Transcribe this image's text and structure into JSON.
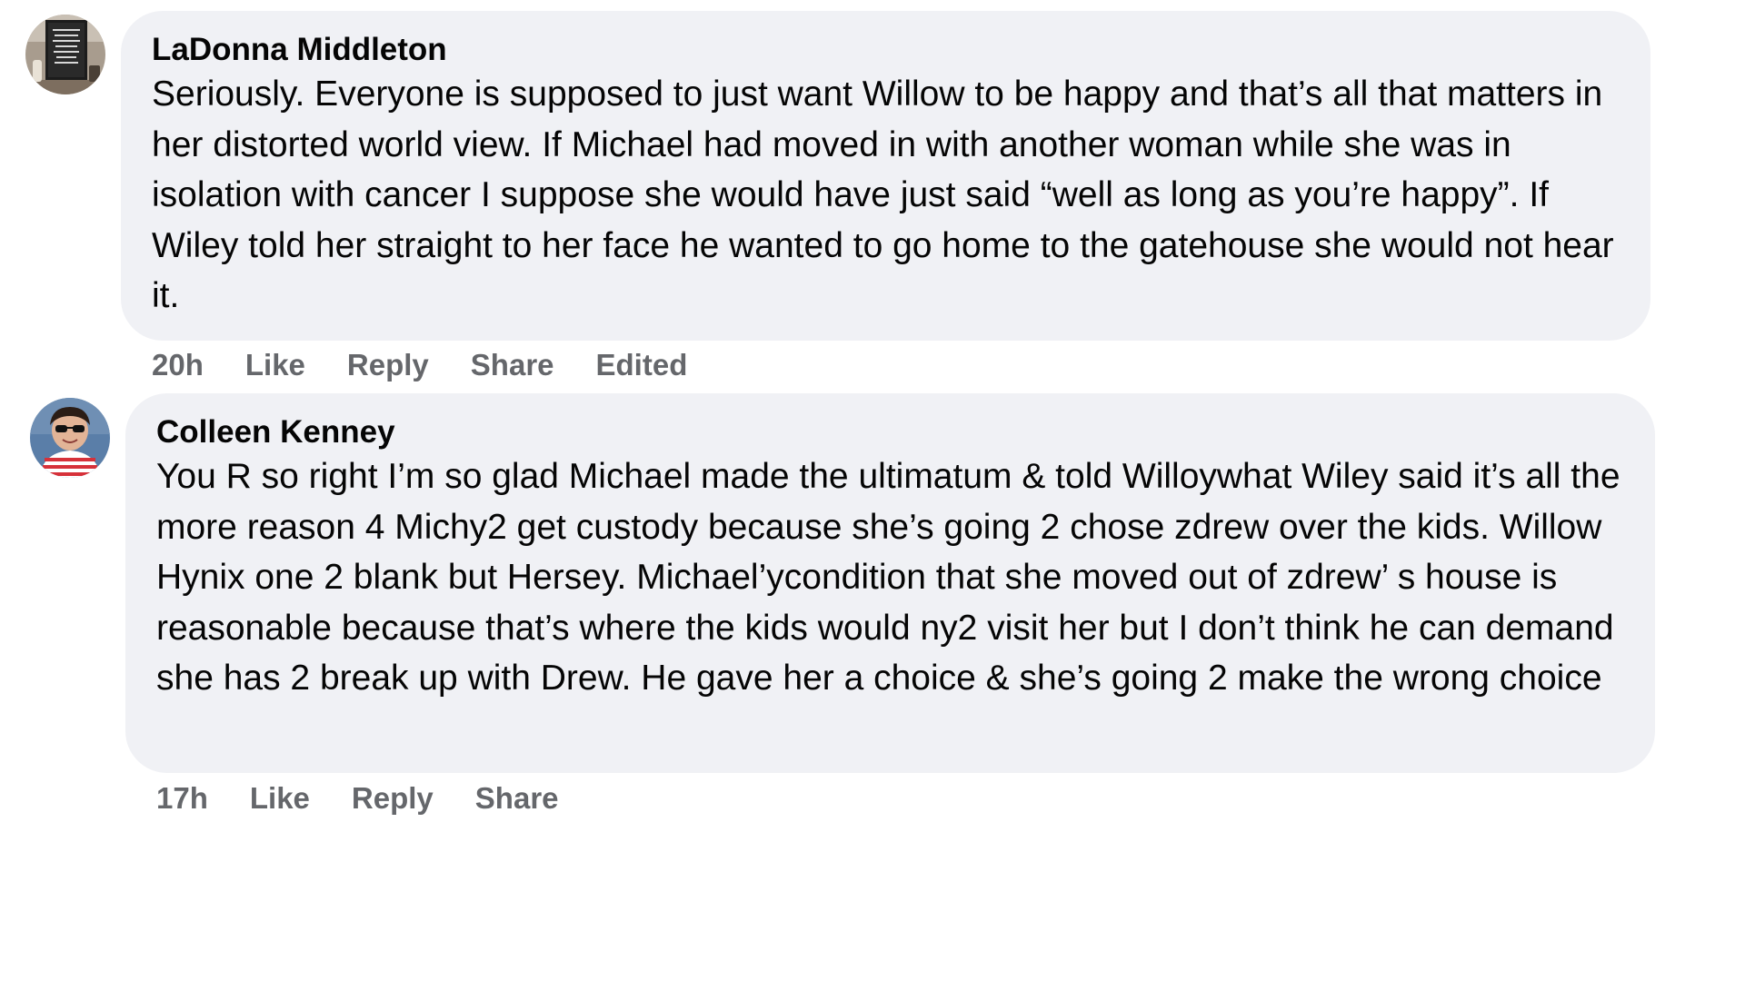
{
  "comments": [
    {
      "author": "LaDonna Middleton",
      "text": "Seriously. Everyone is supposed to just want Willow to be happy and that’s all that matters in her distorted world view. If Michael had moved in with another woman while she was in isolation with cancer I suppose she would have just said “well as long as you’re happy”. If Wiley told her straight to her face he wanted to go home to the gatehouse she would not hear it.",
      "time": "20h",
      "like_label": "Like",
      "reply_label": "Reply",
      "share_label": "Share",
      "edited_label": "Edited",
      "avatar_icon": "framed-sign-avatar"
    },
    {
      "author": "Colleen Kenney",
      "text": "You R so right I’m so glad Michael made the ultimatum & told Willoywhat Wiley said it’s all the more reason 4 Michy2 get custody because she’s going 2 chose zdrew over the kids. Willow Hynix one 2 blank but Hersey. Michael’ycondition that she moved out of zdrew’ s house is reasonable because that’s where the kids would ny2 visit her but I don’t think he can demand she has 2 break up with Drew. He gave her a choice & she’s going 2 make the wrong choice",
      "time": "17h",
      "like_label": "Like",
      "reply_label": "Reply",
      "share_label": "Share",
      "avatar_icon": "person-photo-avatar"
    }
  ],
  "colors": {
    "bubble_bg": "#f0f1f5",
    "text": "#050505",
    "meta": "#65676b"
  }
}
